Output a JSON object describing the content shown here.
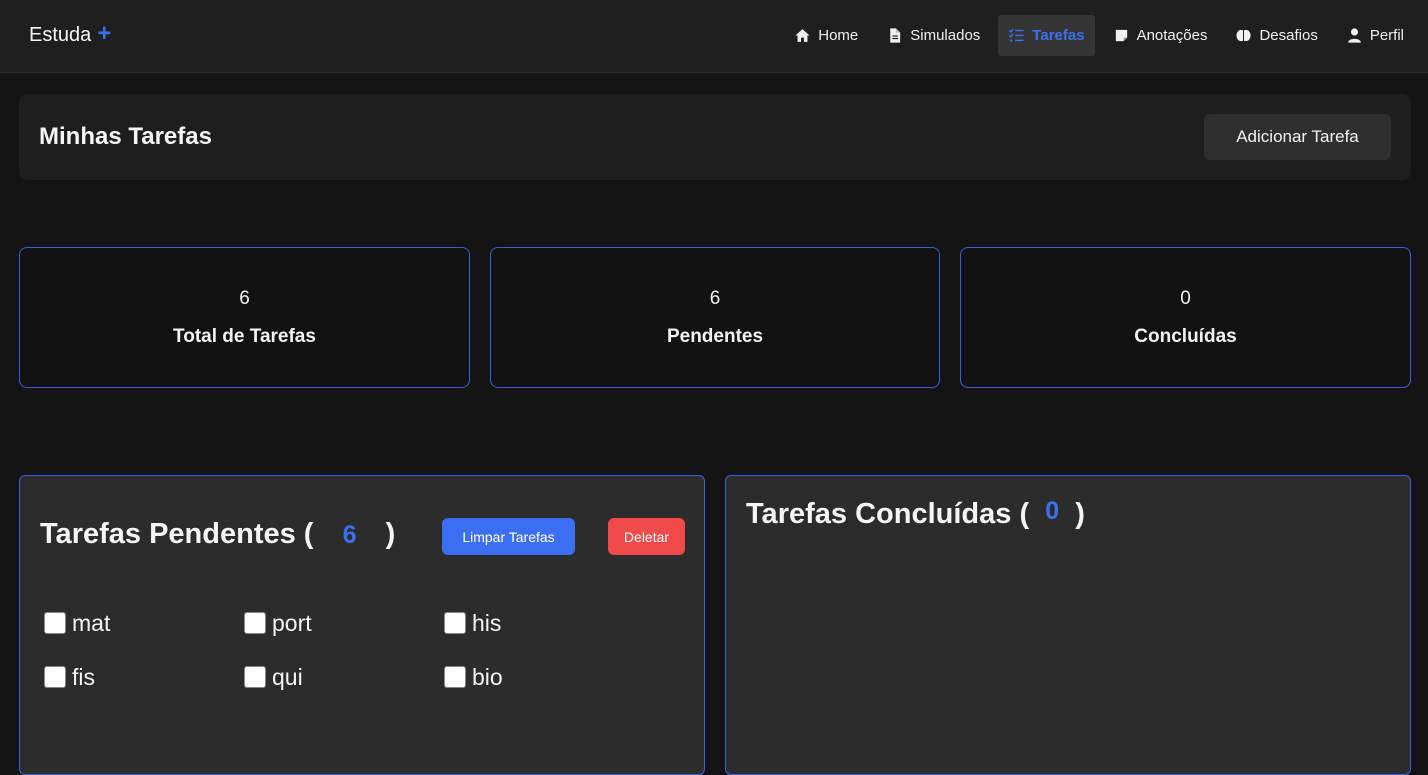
{
  "brand": {
    "name": "Estuda",
    "plus": "+"
  },
  "nav": {
    "items": [
      {
        "label": "Home",
        "icon": "home-icon",
        "active": false
      },
      {
        "label": "Simulados",
        "icon": "file-icon",
        "active": false
      },
      {
        "label": "Tarefas",
        "icon": "list-check-icon",
        "active": true
      },
      {
        "label": "Anotações",
        "icon": "note-icon",
        "active": false
      },
      {
        "label": "Desafios",
        "icon": "brain-icon",
        "active": false
      },
      {
        "label": "Perfil",
        "icon": "user-icon",
        "active": false
      }
    ]
  },
  "header": {
    "title": "Minhas Tarefas",
    "add_button": "Adicionar Tarefa"
  },
  "stats": [
    {
      "value": "6",
      "label": "Total de Tarefas"
    },
    {
      "value": "6",
      "label": "Pendentes"
    },
    {
      "value": "0",
      "label": "Concluídas"
    }
  ],
  "pending": {
    "title": "Tarefas Pendentes",
    "open_paren": "(",
    "count": "6",
    "close_paren": ")",
    "clear_button": "Limpar Tarefas",
    "delete_button": "Deletar",
    "tasks": [
      "mat",
      "port",
      "his",
      "fis",
      "qui",
      "bio"
    ]
  },
  "completed": {
    "title": "Tarefas Concluídas",
    "open_paren": "(",
    "count": "0",
    "close_paren": ")"
  },
  "colors": {
    "accent": "#3d6ff2",
    "danger": "#f04a4a",
    "background": "#141414",
    "card": "#1e1e1e",
    "panel": "#2c2c2c"
  }
}
